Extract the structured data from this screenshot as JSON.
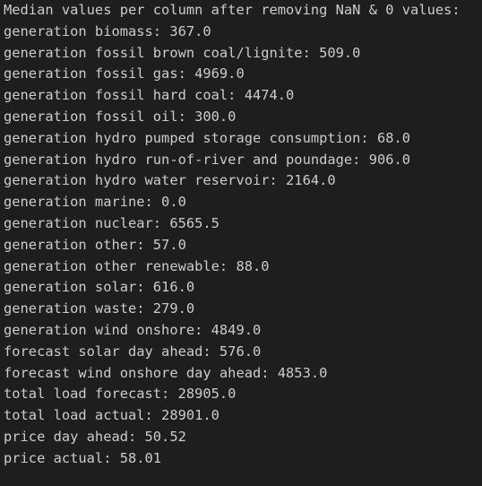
{
  "output": {
    "header": "Median values per column after removing NaN & 0 values:",
    "lines": [
      "generation biomass: 367.0",
      "generation fossil brown coal/lignite: 509.0",
      "generation fossil gas: 4969.0",
      "generation fossil hard coal: 4474.0",
      "generation fossil oil: 300.0",
      "generation hydro pumped storage consumption: 68.0",
      "generation hydro run-of-river and poundage: 906.0",
      "generation hydro water reservoir: 2164.0",
      "generation marine: 0.0",
      "generation nuclear: 6565.5",
      "generation other: 57.0",
      "generation other renewable: 88.0",
      "generation solar: 616.0",
      "generation waste: 279.0",
      "generation wind onshore: 4849.0",
      "forecast solar day ahead: 576.0",
      "forecast wind onshore day ahead: 4853.0",
      "total load forecast: 28905.0",
      "total load actual: 28901.0",
      "price day ahead: 50.52",
      "price actual: 58.01"
    ]
  }
}
